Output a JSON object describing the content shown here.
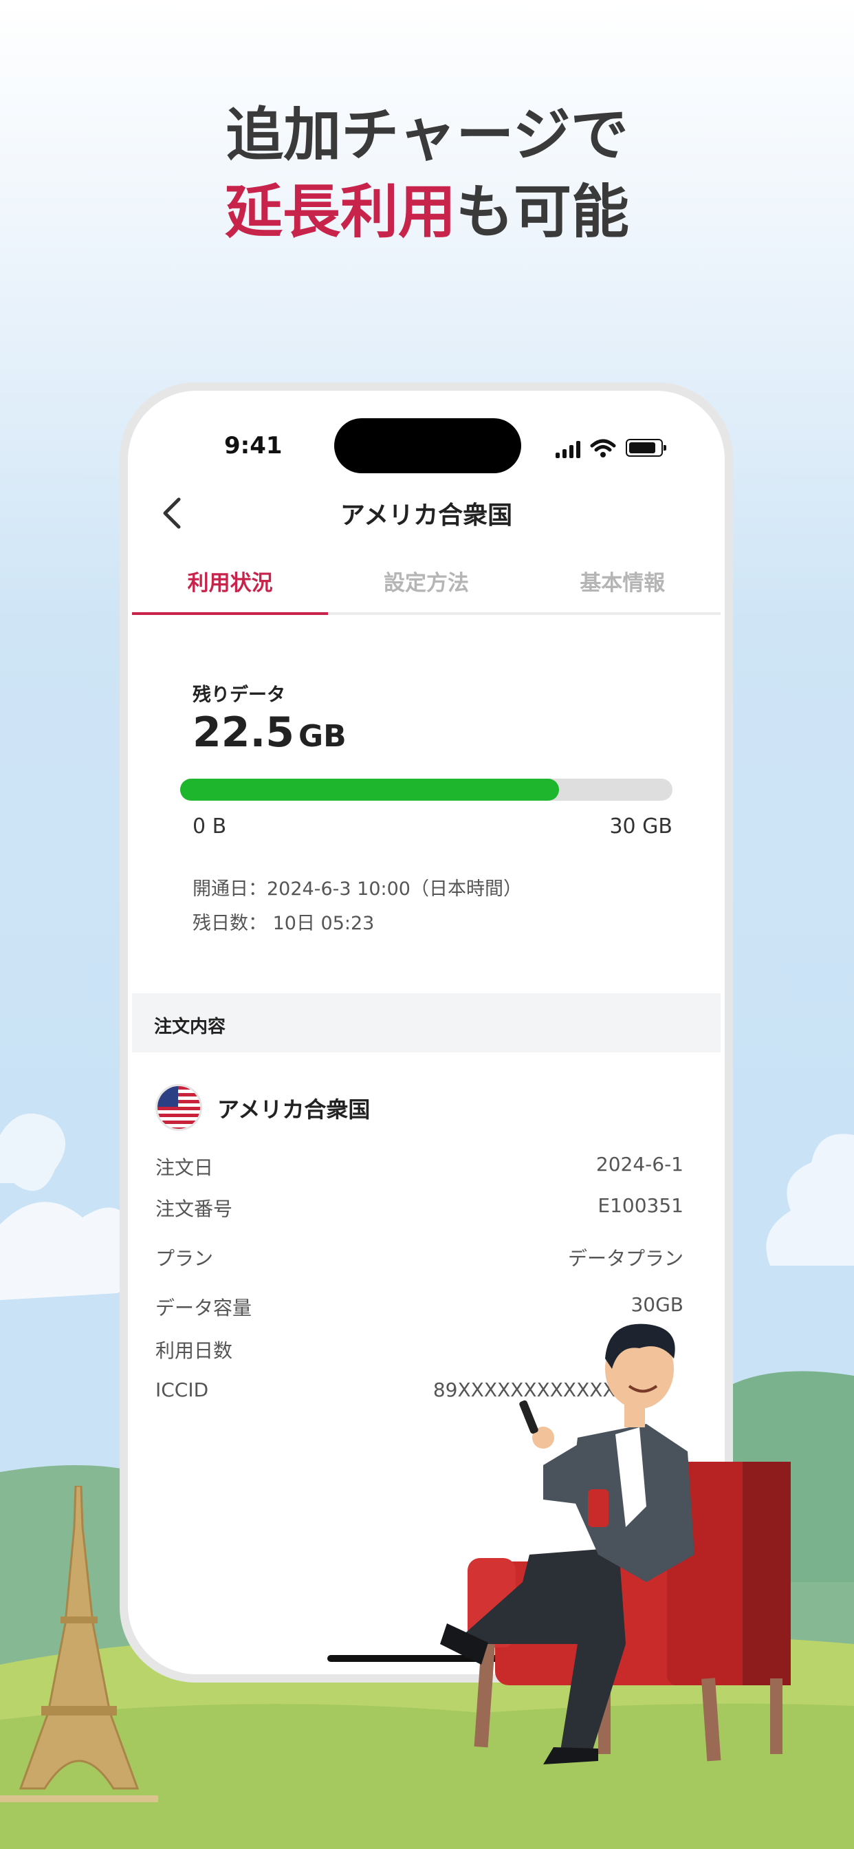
{
  "hero": {
    "line1": "追加チャージで",
    "line2_accent": "延長利用",
    "line2_rest": "も可能"
  },
  "status_bar": {
    "time": "9:41"
  },
  "nav": {
    "title": "アメリカ合衆国",
    "back_icon": "chevron-left-icon"
  },
  "tabs": [
    {
      "label": "利用状況",
      "active": true
    },
    {
      "label": "設定方法",
      "active": false
    },
    {
      "label": "基本情報",
      "active": false
    }
  ],
  "usage": {
    "label": "残りデータ",
    "value": "22.5",
    "unit": "GB",
    "progress_fraction": 0.77,
    "min_label": "0 B",
    "max_label": "30 GB",
    "activation": "開通日：2024-6-3 10:00（日本時間）",
    "remaining_days": "残日数： 10日 05:23"
  },
  "order": {
    "header": "注文内容",
    "country": "アメリカ合衆国",
    "rows": [
      {
        "label": "注文日",
        "value": "2024-6-1"
      },
      {
        "label": "注文番号",
        "value": "E100351"
      },
      {
        "label": "プラン",
        "value": "データプラン"
      },
      {
        "label": "データ容量",
        "value": "30GB"
      },
      {
        "label": "利用日数",
        "value": ""
      },
      {
        "label": "ICCID",
        "value": "89XXXXXXXXXXXXXX"
      }
    ]
  },
  "colors": {
    "accent": "#c8234b",
    "progress": "#1db62d",
    "text": "#3a3a3a"
  }
}
